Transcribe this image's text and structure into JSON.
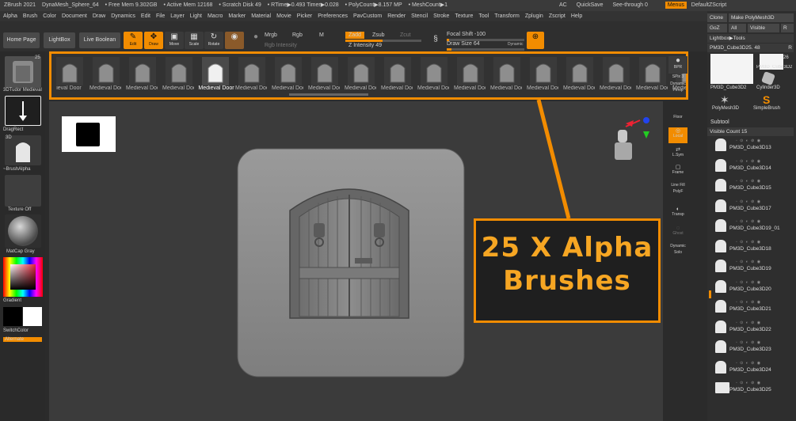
{
  "titlebar": {
    "app": "ZBrush 2021",
    "project": "DynaMesh_Sphere_64",
    "free_mem": "• Free Mem 9.302GB",
    "active_mem": "• Active Mem 12168",
    "scratch": "• Scratch Disk 49",
    "rtime": "• RTime▶0.493 Timer▶0.028",
    "polycount": "• PolyCount▶8.157 MP",
    "meshcount": "• MeshCount▶1",
    "ac": "AC",
    "quicksave": "QuickSave",
    "see_through": "See-through  0",
    "menus": "Menus",
    "script": "DefaultZScript"
  },
  "menubar": [
    "Alpha",
    "Brush",
    "Color",
    "Document",
    "Draw",
    "Dynamics",
    "Edit",
    "File",
    "Layer",
    "Light",
    "Macro",
    "Marker",
    "Material",
    "Movie",
    "Picker",
    "Preferences",
    "PavCustom",
    "Render",
    "Stencil",
    "Stroke",
    "Texture",
    "Tool",
    "Transform",
    "Zplugin",
    "Zscript",
    "Help"
  ],
  "toolbar": {
    "home": "Home Page",
    "lightbox": "LightBox",
    "live_boolean": "Live Boolean",
    "edit": "Edit",
    "draw": "Draw",
    "move": "Move",
    "scale": "Scale",
    "rotate": "Rotate",
    "mrgb": "Mrgb",
    "rgb": "Rgb",
    "m": "M",
    "rgb_intensity": "Rgb Intensity",
    "zadd": "Zadd",
    "zsub": "Zsub",
    "zcut": "Zcut",
    "z_intensity": "Z Intensity 49",
    "focal_shift": "Focal Shift -100",
    "draw_size": "Draw Size 64",
    "dynamic": "Dynamic",
    "z_intensity_level": 0.49,
    "draw_size_level": 0.06
  },
  "leftshelf": {
    "badge": "25",
    "brush_name": "3DTudor Medieval",
    "stroke": "DragRect",
    "alpha_3d": "3D",
    "alpha_name": "~BrushAlpha",
    "texture": "Texture Off",
    "material": "MatCap Gray",
    "gradient": "Gradient",
    "switchcolor": "SwitchColor",
    "alternate": "Alternate"
  },
  "alphastrip": {
    "items": [
      "ieval Door",
      "Medieval Door",
      "Medieval Door",
      "Medieval Door",
      "Medieval Door",
      "Medieval Door",
      "Medieval Door",
      "Medieval Door",
      "Medieval Door",
      "Medieval Door",
      "Medieval Door",
      "Medieval Door",
      "Medieval Door",
      "Medieval Door",
      "Medieval Door",
      "Medieval Door",
      "Medieval Door",
      "Medieval Door",
      "Medieval Door"
    ],
    "selected_index": 4,
    "selected_label": "Medieval Door"
  },
  "callout": {
    "line1": "25 X Alpha",
    "line2": "Brushes"
  },
  "rightstrip": {
    "brill": "BPR",
    "spix": "SPix 3",
    "dynamic": "Dynamic",
    "persp": "Persp",
    "floor": "Floor",
    "local": "Local",
    "lsym": "L.Sym",
    "frame": "Frame",
    "line_fill": "Line Fill",
    "polyf": "PolyF",
    "transp": "Transp",
    "ghost": "Ghost",
    "dynamic2": "Dynamic",
    "solo": "Solo"
  },
  "rightpanel": {
    "clone": "Clone",
    "make_polymesh": "Make PolyMesh3D",
    "goz": "GoZ",
    "all": "All",
    "visible": "Visible",
    "r": "R",
    "lightbox_tools": "Lightbox▶Tools",
    "current_tool": "PM3D_Cube3D25. 48",
    "r2": "R",
    "tool_items": [
      "PM3D_Cube3D2",
      "PM3D_Cube3D2",
      "Cylinder3D",
      "PolyMesh3D",
      "SimpleBrush"
    ],
    "badge_26": "26",
    "subtool": "Subtool",
    "visible_count": "Visible Count 15",
    "subtools": [
      "PM3D_Cube3D13",
      "PM3D_Cube3D14",
      "PM3D_Cube3D15",
      "PM3D_Cube3D17",
      "PM3D_Cube3D19_01",
      "PM3D_Cube3D18",
      "PM3D_Cube3D19",
      "PM3D_Cube3D20",
      "PM3D_Cube3D21",
      "PM3D_Cube3D22",
      "PM3D_Cube3D23",
      "PM3D_Cube3D24",
      "PM3D_Cube3D25"
    ]
  },
  "colors": {
    "accent": "#f28c00",
    "callout_text": "#f6a623",
    "panel": "#2e2e2e"
  }
}
